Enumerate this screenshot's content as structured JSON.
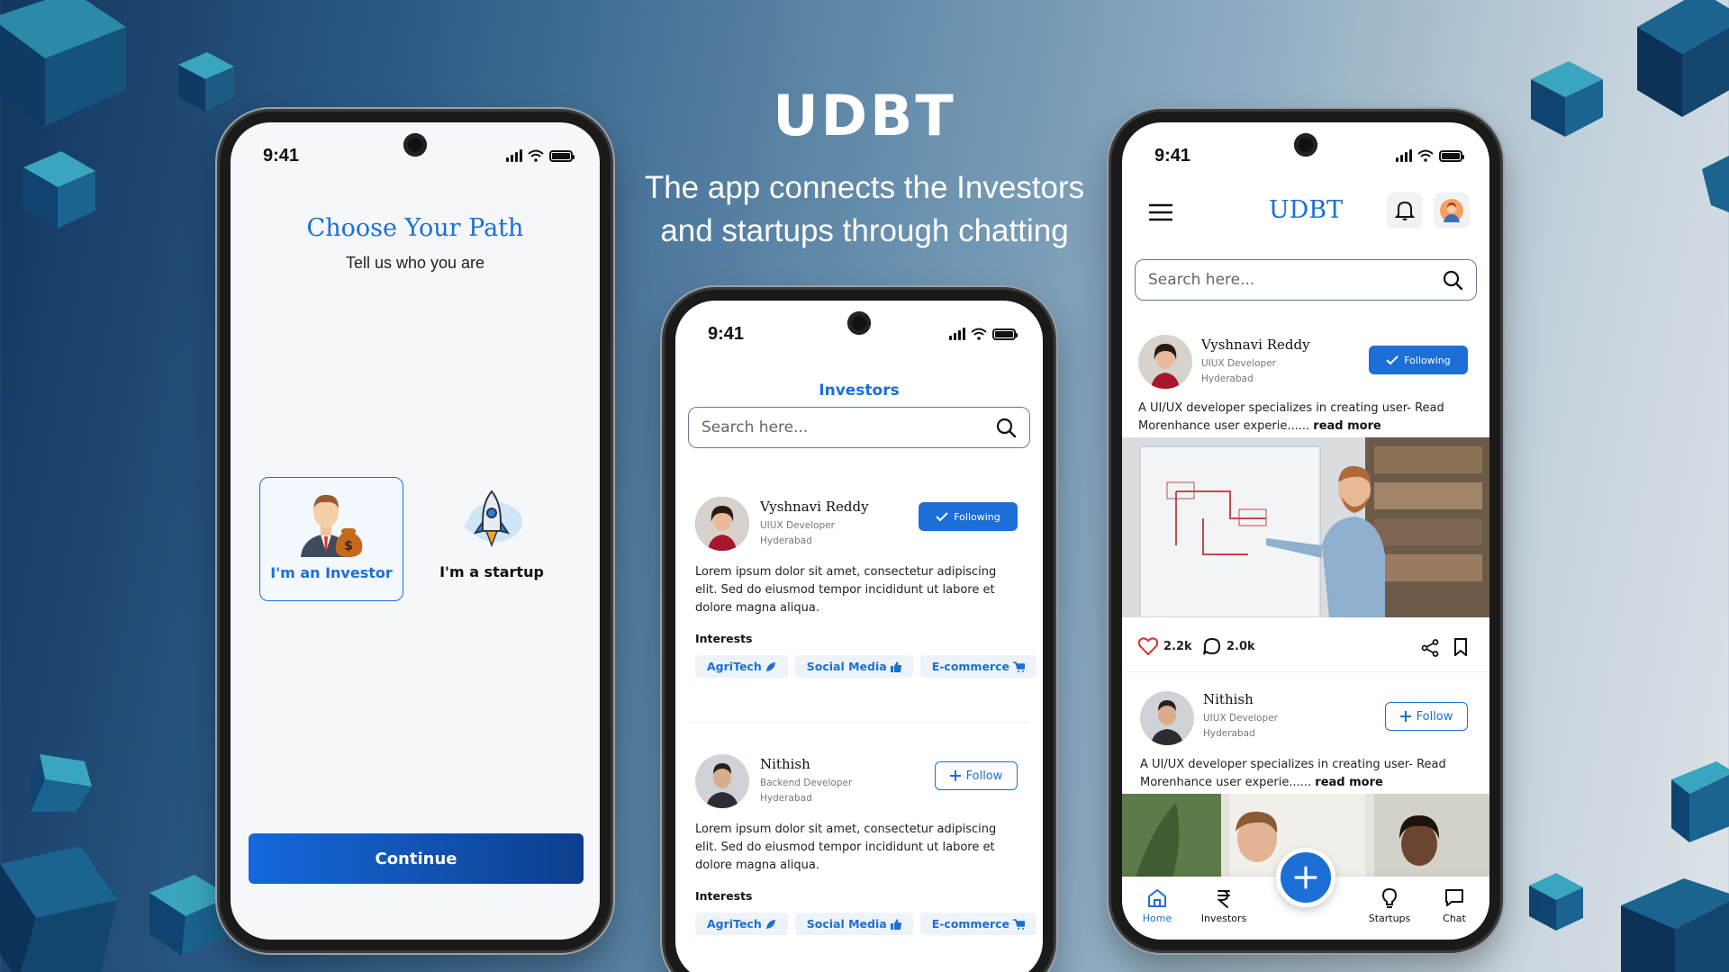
{
  "hero": {
    "title": "UDBT",
    "tagline_line1": "The app connects the Investors",
    "tagline_line2": "and  startups through chatting"
  },
  "status": {
    "time": "9:41"
  },
  "onboarding": {
    "title": "Choose Your Path",
    "subtitle": "Tell us who you are",
    "roles": [
      {
        "label": "I'm an Investor",
        "selected": true
      },
      {
        "label": "I'm a startup",
        "selected": false
      }
    ],
    "continue_label": "Continue"
  },
  "investors": {
    "title": "Investors",
    "search_placeholder": "Search here...",
    "cards": [
      {
        "name": "Vyshnavi Reddy",
        "role": "UIUX Developer",
        "location": "Hyderabad",
        "button": "Following",
        "bio_line1": "Lorem ipsum dolor sit amet, consectetur adipiscing",
        "bio_line2": "elit. Sed do eiusmod tempor incididunt ut labore et",
        "bio_line3": "dolore magna aliqua.",
        "interests_label": "Interests",
        "interests": [
          "AgriTech",
          "Social Media",
          "E-commerce"
        ]
      },
      {
        "name": "Nithish",
        "role": "Backend Developer",
        "location": "Hyderabad",
        "button": "Follow",
        "bio_line1": "Lorem ipsum dolor sit amet, consectetur adipiscing",
        "bio_line2": "elit. Sed do eiusmod tempor incididunt ut labore et",
        "bio_line3": "dolore magna aliqua.",
        "interests_label": "Interests",
        "interests": [
          "AgriTech",
          "Social Media",
          "E-commerce"
        ]
      }
    ]
  },
  "feed": {
    "logo": "UDBT",
    "search_placeholder": "Search here...",
    "posts": [
      {
        "name": "Vyshnavi Reddy",
        "role": "UIUX Developer",
        "location": "Hyderabad",
        "button": "Following",
        "text_line1": "A UI/UX developer specializes in creating user- Read",
        "text_line2": "Morenhance user experie......",
        "read_more": "read more",
        "likes": "2.2k",
        "comments": "2.0k"
      },
      {
        "name": "Nithish",
        "role": "UIUX Developer",
        "location": "Hyderabad",
        "button": "Follow",
        "text_line1": "A UI/UX developer specializes in creating user- Read",
        "text_line2": "Morenhance user experie......",
        "read_more": "read more"
      }
    ],
    "nav": [
      {
        "label": "Home",
        "icon": "home-icon",
        "active": true
      },
      {
        "label": "Investors",
        "icon": "rupee-icon",
        "active": false
      },
      {
        "label": "Startups",
        "icon": "lightbulb-icon",
        "active": false
      },
      {
        "label": "Chat",
        "icon": "chat-icon",
        "active": false
      }
    ]
  },
  "colors": {
    "accent": "#1b6fd6",
    "accent_dark": "#0d3f8c",
    "heart": "#e0302f"
  }
}
